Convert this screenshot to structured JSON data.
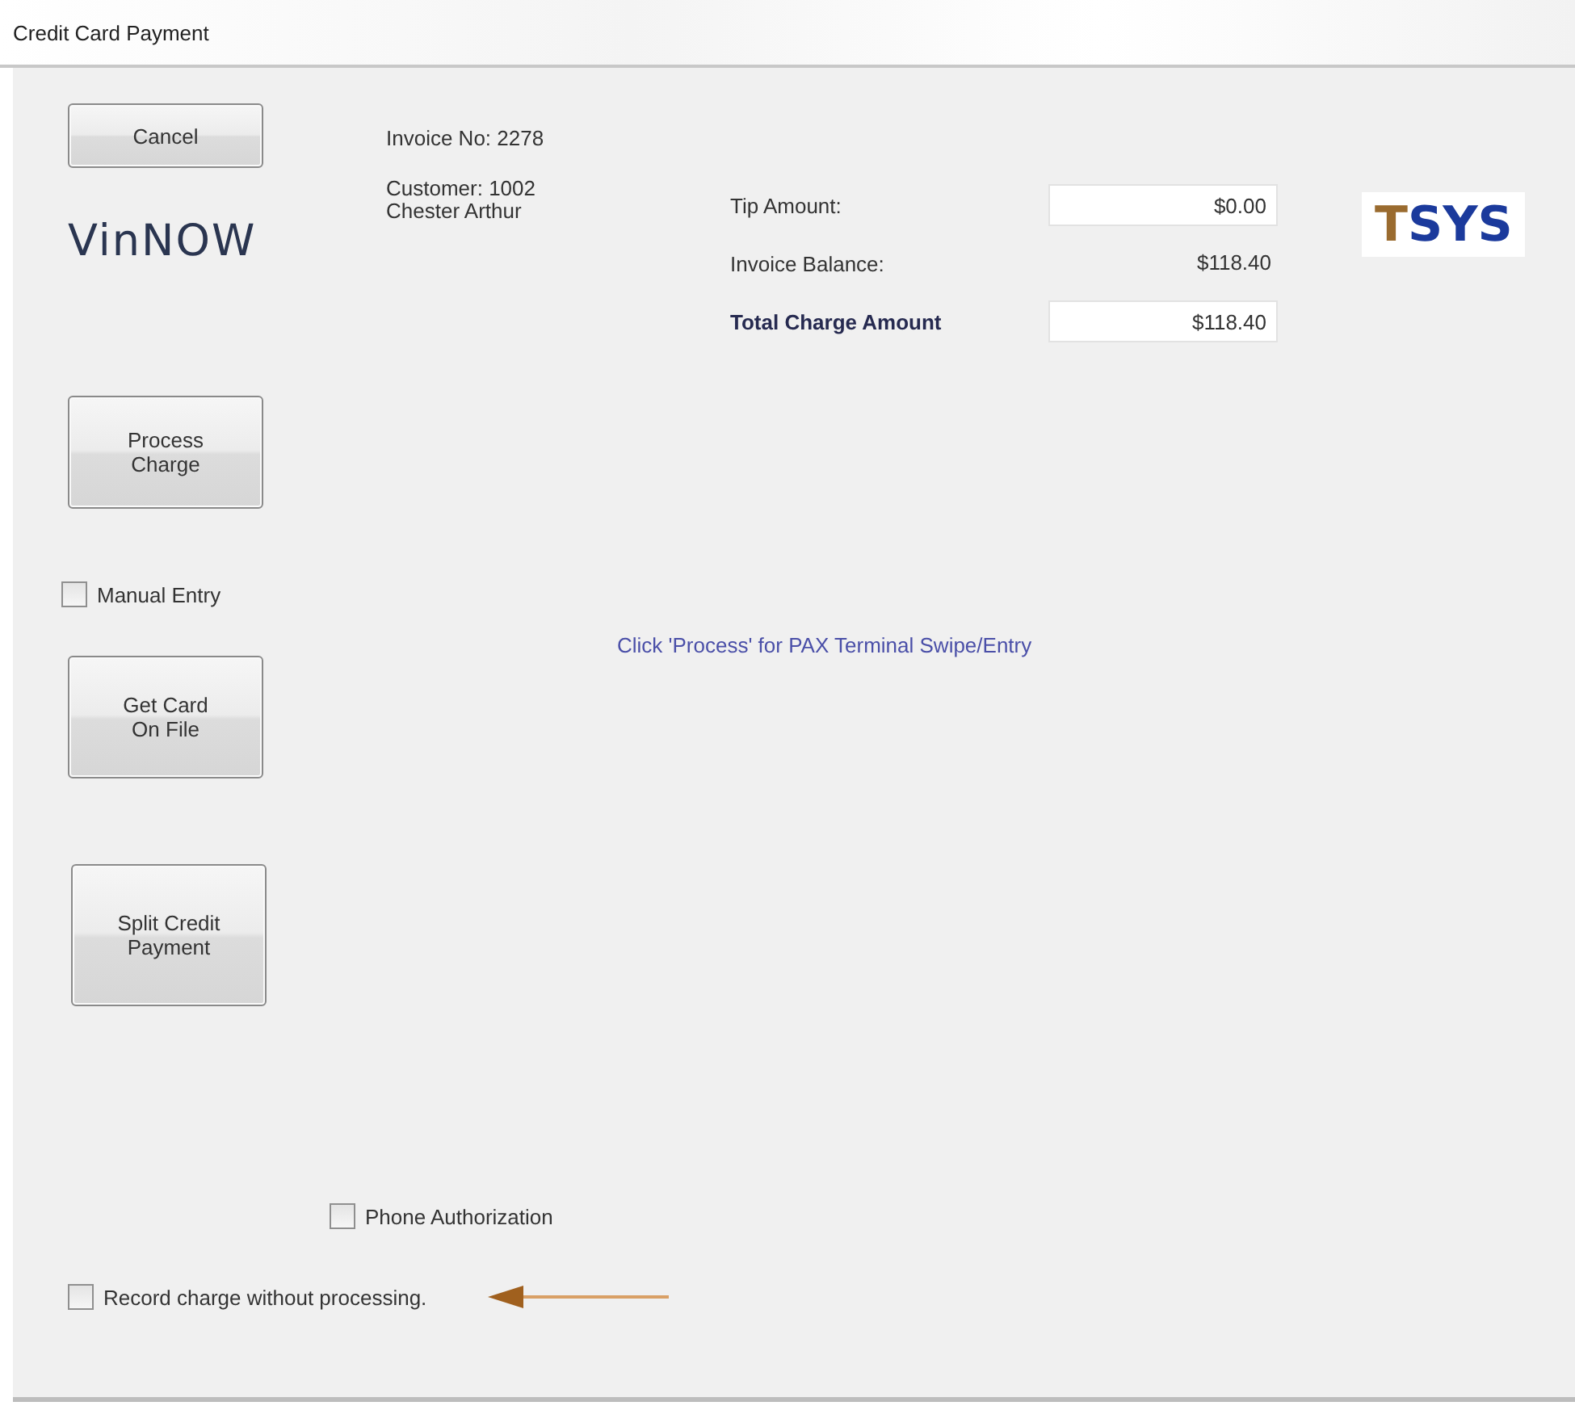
{
  "window": {
    "title": "Credit Card Payment"
  },
  "actions": [
    {
      "kind": "button",
      "lines": [
        "Cancel"
      ]
    },
    {
      "kind": "logo",
      "text": "VinNOW"
    },
    {
      "kind": "button",
      "lines": [
        "Process",
        "Charge"
      ]
    },
    {
      "kind": "checkbox",
      "label": "Manual Entry",
      "checked": false
    },
    {
      "kind": "button",
      "lines": [
        "Get Card",
        "On File"
      ]
    },
    {
      "kind": "button",
      "lines": [
        "Split Credit",
        "Payment"
      ]
    }
  ],
  "invoice": {
    "number": "Invoice No: 2278",
    "customer_lines": [
      "Customer:  1002",
      "Chester Arthur"
    ]
  },
  "amounts": [
    {
      "kind": "field",
      "label": "Tip Amount:",
      "value": "$0.00",
      "bold": false
    },
    {
      "kind": "text",
      "label": "Invoice Balance:",
      "value": "$118.40",
      "bold": false
    },
    {
      "kind": "field",
      "label": "Total Charge Amount",
      "value": "$118.40",
      "bold": true
    }
  ],
  "processor_logo": [
    {
      "text": "T",
      "color": "#9a6b2f"
    },
    {
      "text": "SYS",
      "color": "#1b3a9c"
    }
  ],
  "message": "Click 'Process' for PAX Terminal Swipe/Entry",
  "phone_authorization": {
    "label": "Phone Authorization",
    "checked": false
  },
  "record_charge": {
    "label": "Record charge without processing.",
    "checked": false
  }
}
